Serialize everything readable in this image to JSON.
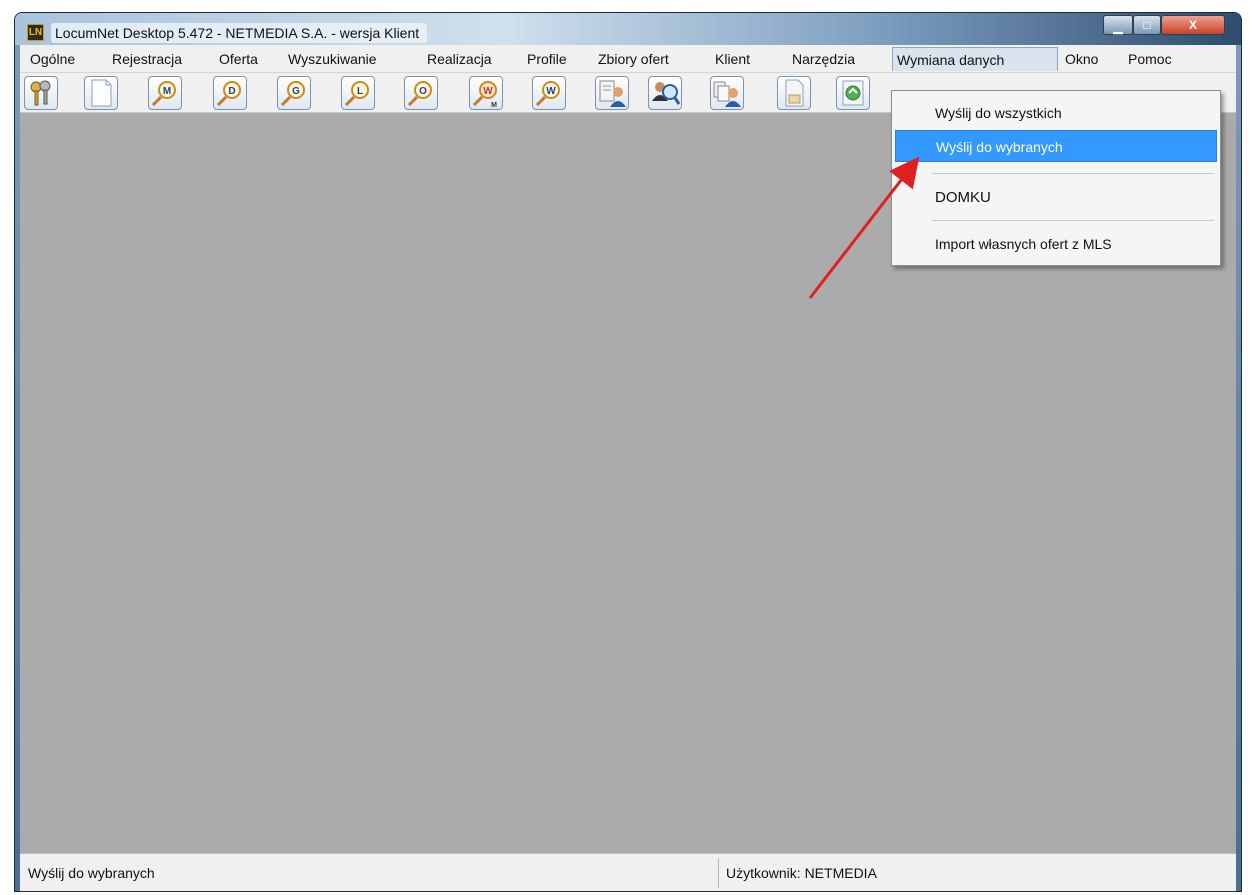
{
  "window": {
    "app_logo_text": "LN",
    "title": "LocumNet Desktop 5.472 - NETMEDIA S.A. - wersja Klient",
    "controls": {
      "minimize": "▁",
      "maximize": "□",
      "close": "X"
    }
  },
  "menubar": {
    "items": [
      {
        "label": "Ogólne"
      },
      {
        "label": "Rejestracja"
      },
      {
        "label": "Oferta"
      },
      {
        "label": "Wyszukiwanie"
      },
      {
        "label": "Realizacja"
      },
      {
        "label": "Profile"
      },
      {
        "label": "Zbiory ofert"
      },
      {
        "label": "Klient"
      },
      {
        "label": "Narzędzia"
      },
      {
        "label": "Wymiana danych"
      },
      {
        "label": "Okno"
      },
      {
        "label": "Pomoc"
      }
    ]
  },
  "toolbar": {
    "buttons": [
      {
        "icon": "keys-icon"
      },
      {
        "icon": "new-document-icon"
      },
      {
        "icon": "search-m-icon",
        "letter": "M"
      },
      {
        "icon": "search-d-icon",
        "letter": "D"
      },
      {
        "icon": "search-g-icon",
        "letter": "G"
      },
      {
        "icon": "search-l-icon",
        "letter": "L"
      },
      {
        "icon": "search-o-icon",
        "letter": "O"
      },
      {
        "icon": "search-wm-icon",
        "letter": "W",
        "sub": "M"
      },
      {
        "icon": "search-w-icon",
        "letter": "W"
      },
      {
        "icon": "add-client-icon"
      },
      {
        "icon": "search-client-icon"
      },
      {
        "icon": "client-documents-icon"
      },
      {
        "icon": "document-icon"
      },
      {
        "icon": "exchange-icon"
      }
    ]
  },
  "dropdown": {
    "items": [
      {
        "label": "Wyślij do wszystkich"
      },
      {
        "label": "Wyślij do wybranych",
        "selected": true
      },
      {
        "label": "DOMKU"
      },
      {
        "label": "Import własnych ofert z MLS"
      }
    ]
  },
  "statusbar": {
    "left": "Wyślij do wybranych",
    "right": "Użytkownik: NETMEDIA"
  },
  "colors": {
    "selection": "#3399ff",
    "workspace": "#ababab",
    "arrow": "#e02020"
  }
}
